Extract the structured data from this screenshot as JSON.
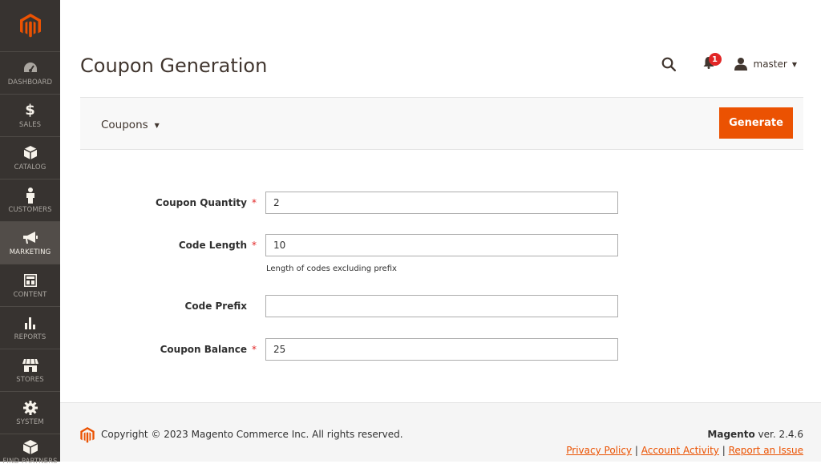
{
  "sidebar": {
    "items": [
      {
        "label": "DASHBOARD",
        "icon": "dashboard-icon"
      },
      {
        "label": "SALES",
        "icon": "dollar-icon"
      },
      {
        "label": "CATALOG",
        "icon": "cube-icon"
      },
      {
        "label": "CUSTOMERS",
        "icon": "person-icon"
      },
      {
        "label": "MARKETING",
        "icon": "megaphone-icon",
        "active": true
      },
      {
        "label": "CONTENT",
        "icon": "content-icon"
      },
      {
        "label": "REPORTS",
        "icon": "bar-chart-icon"
      },
      {
        "label": "STORES",
        "icon": "store-icon"
      },
      {
        "label": "SYSTEM",
        "icon": "gear-icon"
      },
      {
        "label": "FIND PARTNERS",
        "icon": "partners-icon"
      }
    ]
  },
  "header": {
    "title": "Coupon Generation",
    "notification_count": "1",
    "user_name": "master"
  },
  "toolbar": {
    "dropdown_label": "Coupons",
    "generate_label": "Generate"
  },
  "form": {
    "coupon_quantity": {
      "label": "Coupon Quantity",
      "value": "2",
      "required": true
    },
    "code_length": {
      "label": "Code Length",
      "value": "10",
      "required": true,
      "note": "Length of codes excluding prefix"
    },
    "code_prefix": {
      "label": "Code Prefix",
      "value": "",
      "required": false
    },
    "coupon_balance": {
      "label": "Coupon Balance",
      "value": "25",
      "required": true
    },
    "required_marker": "*"
  },
  "footer": {
    "copyright": "Copyright © 2023 Magento Commerce Inc. All rights reserved.",
    "brand": "Magento",
    "version": " ver. 2.4.6",
    "links": [
      "Privacy Policy",
      "Account Activity",
      "Report an Issue"
    ],
    "separator": "|"
  },
  "colors": {
    "sidebar_bg": "#373330",
    "accent": "#eb5202",
    "required": "#e22626"
  }
}
